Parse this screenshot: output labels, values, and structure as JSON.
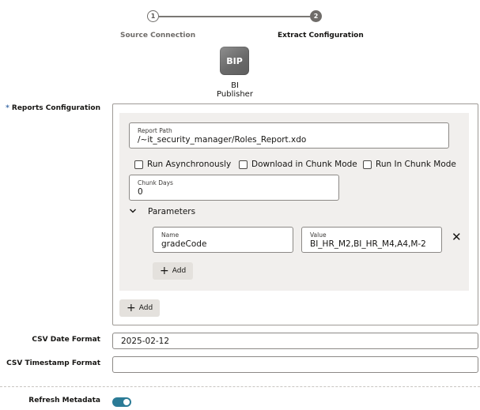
{
  "stepper": {
    "steps": [
      {
        "number": "1",
        "label": "Source Connection"
      },
      {
        "number": "2",
        "label": "Extract Configuration"
      }
    ]
  },
  "source": {
    "logo_text": "BIP",
    "name": "BI Publisher"
  },
  "reports_config": {
    "required_mark": "*",
    "label": "Reports Configuration",
    "report_path": {
      "label": "Report Path",
      "value": "/~it_security_manager/Roles_Report.xdo"
    },
    "checkboxes": [
      {
        "label": "Run Asynchronously",
        "checked": false
      },
      {
        "label": "Download in Chunk Mode",
        "checked": false
      },
      {
        "label": "Run In Chunk Mode",
        "checked": false
      }
    ],
    "chunk_days": {
      "label": "Chunk Days",
      "value": "0"
    },
    "parameters": {
      "title": "Parameters",
      "expanded": true,
      "rows": [
        {
          "name_label": "Name",
          "name_value": "gradeCode",
          "value_label": "Value",
          "value_value": "BI_HR_M2,BI_HR_M4,A4,M-2"
        }
      ],
      "add_label": "Add"
    },
    "add_label": "Add"
  },
  "csv_date_format": {
    "label": "CSV Date Format",
    "value": "2025-02-12"
  },
  "csv_timestamp_format": {
    "label": "CSV Timestamp Format",
    "value": ""
  },
  "refresh_metadata": {
    "label": "Refresh Metadata",
    "enabled": true
  },
  "colors": {
    "accent": "#2b7b96",
    "required": "#3f6da8",
    "panel_bg": "#f1efed",
    "button_bg": "#e4e1dd"
  }
}
